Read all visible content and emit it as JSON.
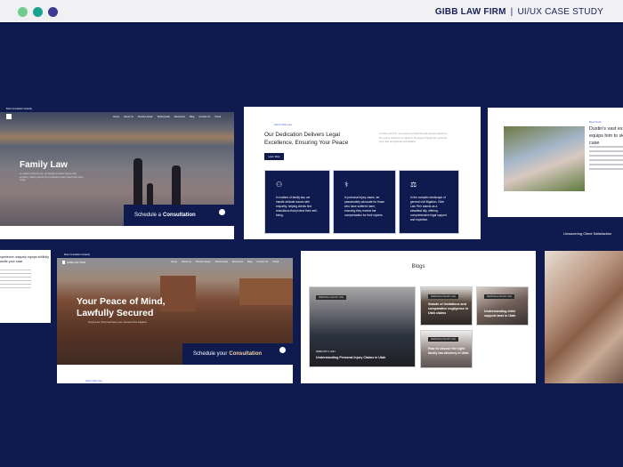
{
  "header": {
    "brand": "GIBB LAW FIRM",
    "subtitle": "UI/UX CASE STUDY",
    "dots": [
      "#6fce8e",
      "#17a38e",
      "#3d3a91"
    ]
  },
  "family_law": {
    "top_notice": "Book Consultation Instantly",
    "nav": [
      "Home",
      "About Us",
      "Practice Areas",
      "Testimonials",
      "Resources",
      "Blog",
      "Contact Us",
      "Portal"
    ],
    "title": "Family Law",
    "desc": "In matters of family law, we handle sensitive issues with empathy, helping clients find resolutions that protect their well-being.",
    "schedule_prefix": "Schedule a",
    "schedule_bold": "Consultation"
  },
  "about": {
    "eyebrow": "About Gibb Law",
    "heading": "Our Dedication Delivers Legal Excellence, Ensuring Your Peace",
    "intro": "At Gibb Law Firm, we provide exceptional legal services tailored to the unique needs of our clients in the areas of family law, personal injury law, and general civil litigation.",
    "button": "Learn More",
    "cards": [
      {
        "icon": "family-icon",
        "text": "In matters of family law, we handle delicate issues with empathy, helping clients find resolutions that protect their well-being."
      },
      {
        "icon": "injury-icon",
        "text": "In personal injury cases, we passionately advocate for those who have suffered harm, ensuring they receive fair compensation for their injuries."
      },
      {
        "icon": "scales-icon",
        "text": "In the complex landscape of general civil litigation, Gibb Law Firm stands as a steadfast ally, offering comprehensive legal support and expertise."
      }
    ]
  },
  "dustin": {
    "eyebrow": "Meet Dustin",
    "heading": "Dustin's vast experience uniquely equips him to skillfully handle your case",
    "caption": "Unwavering Client Satisfaction"
  },
  "left_partial": {
    "heading": "experience uniquely equips skillfully handle your case"
  },
  "hero": {
    "top_notice": "Book Consultation Instantly",
    "logo": "GIBB LAW FIRM",
    "nav": [
      "Home",
      "About Us",
      "Practice Areas",
      "Testimonials",
      "Resources",
      "Blog",
      "Contact Us",
      "Portal"
    ],
    "title_line1": "Your Peace of Mind,",
    "title_line2": "Lawfully Secured",
    "subtitle": "Family Law | Personal Injury Law | General Civil Litigation",
    "schedule_prefix": "Schedule your",
    "schedule_bold": "Consultation",
    "below": "About Gibb Law"
  },
  "blogs": {
    "title": "Blogs",
    "posts": [
      {
        "tag": "PERSONAL INJURY LAW",
        "date": "FEBRUARY 5, 2024",
        "title": "Understanding Personal Injury Claims in Utah"
      },
      {
        "tag": "PERSONAL INJURY LAW",
        "title": "Statute of limitations and comparative negligence in Utah claims"
      },
      {
        "tag": "PERSONAL INJURY LAW",
        "title": "Understanding child support laws in Utah"
      },
      {
        "tag": "PERSONAL INJURY LAW",
        "title": "How to choose the right family law attorney in Utah"
      }
    ]
  }
}
